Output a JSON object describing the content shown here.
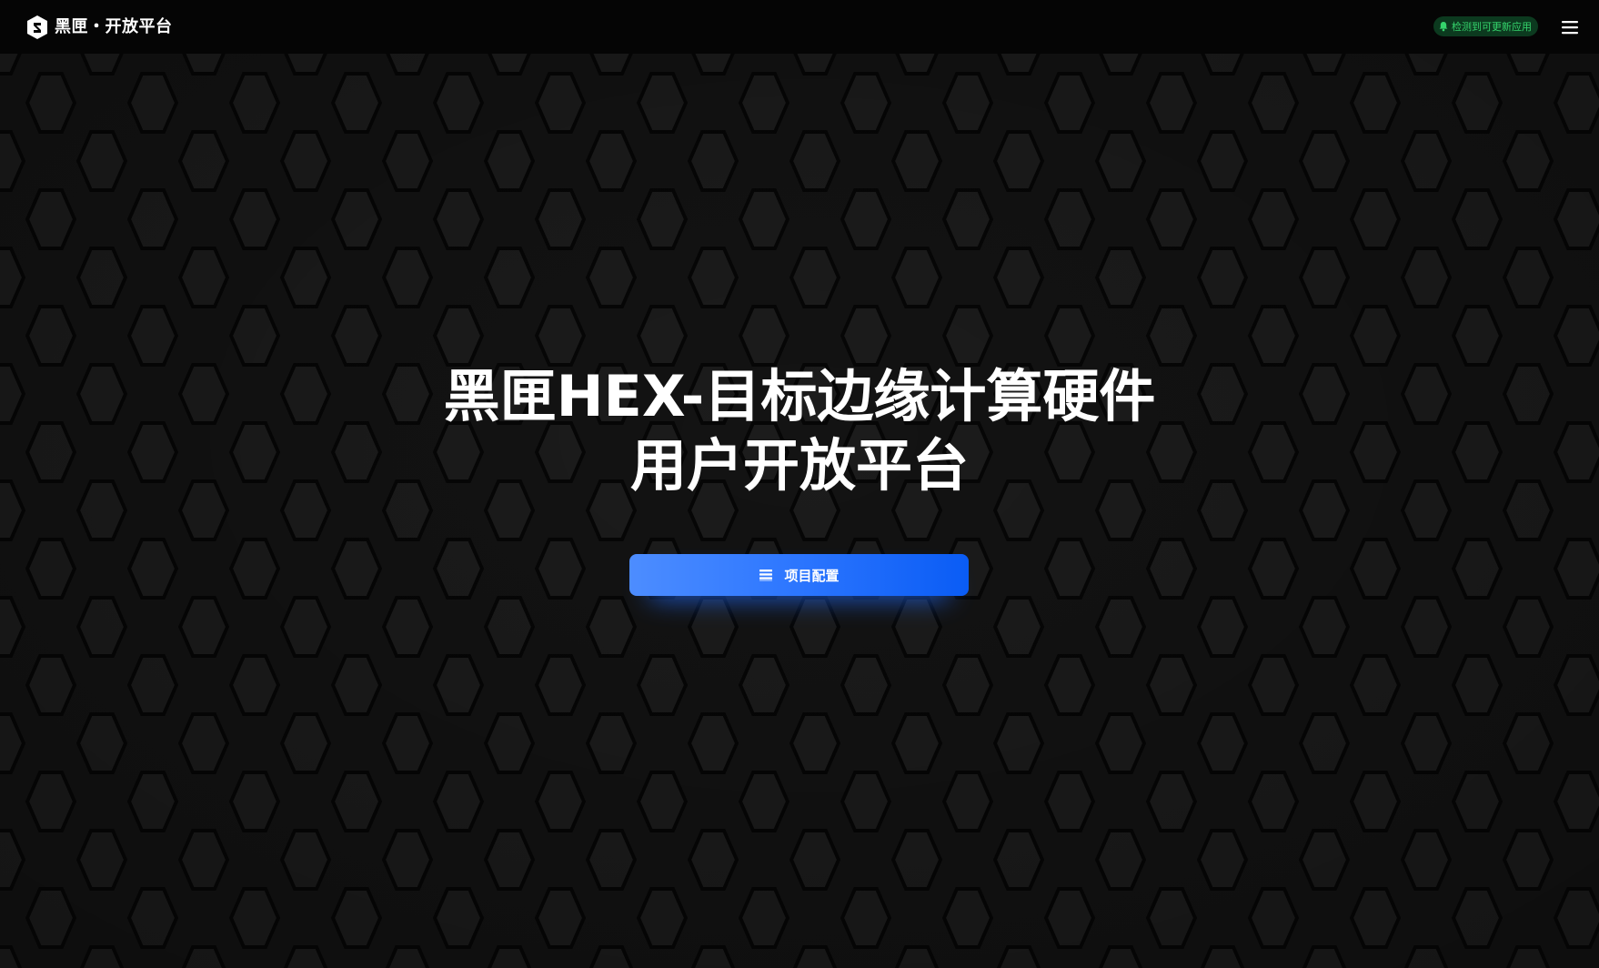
{
  "header": {
    "brand_text": "黑匣・开放平台",
    "update_badge": "检测到可更新应用"
  },
  "hero": {
    "title_line1": "黑匣HEX-目标边缘计算硬件",
    "title_line2": "用户开放平台",
    "cta_label": "项目配置"
  },
  "colors": {
    "background": "#151515",
    "topbar": "#050505",
    "accent_blue": "#2f78ff",
    "badge_bg": "#0c3a1f",
    "badge_text": "#35d46c"
  },
  "icons": {
    "logo": "brand-logo-icon",
    "badge": "bell-icon",
    "menu": "hamburger-menu-icon",
    "cta": "list-icon"
  }
}
